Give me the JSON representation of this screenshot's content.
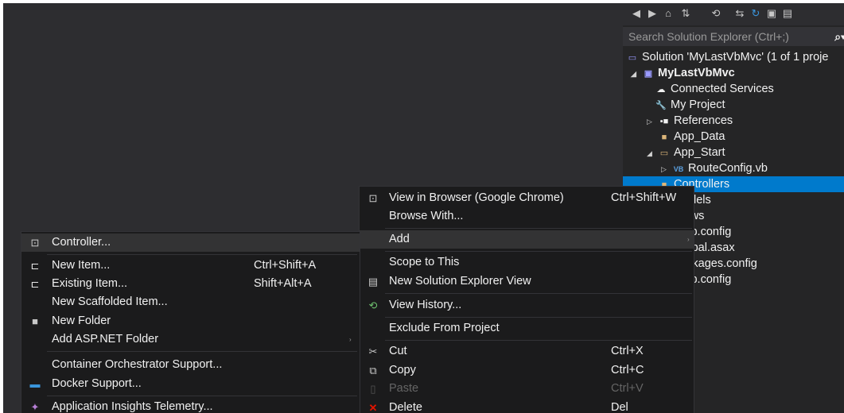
{
  "solution_explorer": {
    "search_placeholder": "Search Solution Explorer (Ctrl+;)",
    "toolbar_icons": [
      "back-icon",
      "forward-icon",
      "home-icon",
      "sync-icon",
      "history-icon",
      "pending-changes-icon",
      "refresh-icon",
      "collapse-icon",
      "properties-icon"
    ],
    "tree": [
      {
        "label": "Solution 'MyLastVbMvc' (1 of 1 proje",
        "icon": "solution-icon"
      },
      {
        "label": "MyLastVbMvc",
        "icon": "project-icon"
      },
      {
        "label": "Connected Services",
        "icon": "connected-services-icon"
      },
      {
        "label": "My Project",
        "icon": "wrench-icon"
      },
      {
        "label": "References",
        "icon": "references-icon"
      },
      {
        "label": "App_Data",
        "icon": "folder-icon"
      },
      {
        "label": "App_Start",
        "icon": "folder-open-icon"
      },
      {
        "label": "RouteConfig.vb",
        "icon": "vb-file-icon"
      },
      {
        "label": "Controllers",
        "icon": "folder-icon"
      },
      {
        "label": "Models",
        "icon": "folder-icon"
      },
      {
        "label": "Views",
        "icon": "folder-icon"
      },
      {
        "label": "Web.config",
        "icon": "config-icon"
      },
      {
        "label": "Global.asax",
        "icon": "file-icon"
      },
      {
        "label": "packages.config",
        "icon": "config-icon"
      },
      {
        "label": "Web.config",
        "icon": "config-icon"
      }
    ]
  },
  "context_menu": {
    "items": [
      {
        "label": "View in Browser (Google Chrome)",
        "shortcut": "Ctrl+Shift+W",
        "icon": "browser-icon"
      },
      {
        "label": "Browse With...",
        "shortcut": "",
        "icon": ""
      },
      {
        "label": "Add",
        "shortcut": "",
        "icon": "",
        "submenu": "›"
      },
      {
        "label": "Scope to This",
        "shortcut": "",
        "icon": ""
      },
      {
        "label": "New Solution Explorer View",
        "shortcut": "",
        "icon": "new-view-icon"
      },
      {
        "label": "View History...",
        "shortcut": "",
        "icon": "history-icon"
      },
      {
        "label": "Exclude From Project",
        "shortcut": "",
        "icon": ""
      },
      {
        "label": "Cut",
        "shortcut": "Ctrl+X",
        "icon": "cut-icon"
      },
      {
        "label": "Copy",
        "shortcut": "Ctrl+C",
        "icon": "copy-icon"
      },
      {
        "label": "Paste",
        "shortcut": "Ctrl+V",
        "icon": "paste-icon"
      },
      {
        "label": "Delete",
        "shortcut": "Del",
        "icon": "delete-icon"
      }
    ]
  },
  "add_submenu": {
    "items": [
      {
        "label": "Controller...",
        "shortcut": "",
        "icon": "controller-icon"
      },
      {
        "label": "New Item...",
        "shortcut": "Ctrl+Shift+A",
        "icon": "new-item-icon"
      },
      {
        "label": "Existing Item...",
        "shortcut": "Shift+Alt+A",
        "icon": "existing-item-icon"
      },
      {
        "label": "New Scaffolded Item...",
        "shortcut": "",
        "icon": ""
      },
      {
        "label": "New Folder",
        "shortcut": "",
        "icon": "new-folder-icon"
      },
      {
        "label": "Add ASP.NET Folder",
        "shortcut": "",
        "icon": "",
        "submenu": "›"
      },
      {
        "label": "Container Orchestrator Support...",
        "shortcut": "",
        "icon": ""
      },
      {
        "label": "Docker Support...",
        "shortcut": "",
        "icon": "docker-icon"
      },
      {
        "label": "Application Insights Telemetry...",
        "shortcut": "",
        "icon": "insights-icon"
      }
    ]
  },
  "colors": {
    "background": "#2d2d30",
    "selection": "#007acc",
    "menu": "#1b1b1c",
    "menu_highlight": "#333334"
  }
}
